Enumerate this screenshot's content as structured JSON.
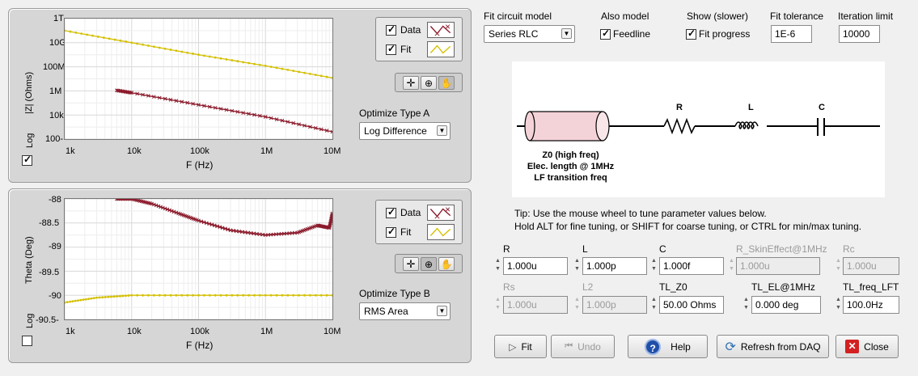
{
  "top_chart": {
    "y_label": "|Z| (Ohms)",
    "x_label": "F (Hz)",
    "y_ticks": [
      "1T",
      "10G",
      "100M",
      "1M",
      "10k",
      "100-"
    ],
    "x_ticks": [
      "1k",
      "10k",
      "100k",
      "1M",
      "10M"
    ],
    "log_label": "Log",
    "log_checked": true,
    "legend_data": "Data",
    "legend_fit": "Fit",
    "optimize_label": "Optimize Type A",
    "optimize_value": "Log Difference"
  },
  "bottom_chart": {
    "y_label": "Theta (Deg)",
    "x_label": "F (Hz)",
    "y_ticks": [
      "-88",
      "-88.5",
      "-89",
      "-89.5",
      "-90",
      "-90.5-"
    ],
    "x_ticks": [
      "1k",
      "10k",
      "100k",
      "1M",
      "10M"
    ],
    "log_label": "Log",
    "log_checked": false,
    "legend_data": "Data",
    "legend_fit": "Fit",
    "optimize_label": "Optimize Type B",
    "optimize_value": "RMS Area"
  },
  "chart_data": [
    {
      "type": "line",
      "title": "",
      "xlabel": "F (Hz)",
      "ylabel": "|Z| (Ohms)",
      "x_scale": "log",
      "y_scale": "log",
      "xlim": [
        1000,
        10000000
      ],
      "ylim": [
        100,
        1000000000000
      ],
      "series": [
        {
          "name": "Data",
          "color": "#8b1a2b",
          "x": [
            6000,
            10000,
            100000,
            1000000,
            10000000
          ],
          "y": [
            1100000,
            700000,
            70000,
            7000,
            400
          ]
        },
        {
          "name": "Fit",
          "color": "#d4c000",
          "x": [
            1000,
            10000,
            100000,
            1000000,
            10000000
          ],
          "y": [
            100000000000,
            10000000000,
            1000000000,
            120000000,
            12000000
          ]
        }
      ]
    },
    {
      "type": "line",
      "title": "",
      "xlabel": "F (Hz)",
      "ylabel": "Theta (Deg)",
      "x_scale": "log",
      "xlim": [
        1000,
        10000000
      ],
      "ylim": [
        -90.5,
        -88
      ],
      "series": [
        {
          "name": "Data",
          "color": "#8b1a2b",
          "x": [
            6000,
            10000,
            20000,
            50000,
            100000,
            300000,
            1000000,
            3000000,
            6000000,
            9000000,
            10000000
          ],
          "y": [
            -88.0,
            -88.0,
            -88.1,
            -88.3,
            -88.45,
            -88.65,
            -88.75,
            -88.7,
            -88.55,
            -88.6,
            -88.3
          ]
        },
        {
          "name": "Fit",
          "color": "#d4c000",
          "x": [
            1000,
            3000,
            10000,
            100000,
            1000000,
            10000000
          ],
          "y": [
            -90.15,
            -90.05,
            -90.0,
            -90.0,
            -90.0,
            -90.0
          ]
        }
      ]
    }
  ],
  "controls": {
    "fit_model_label": "Fit circuit model",
    "fit_model_value": "Series RLC",
    "also_model_label": "Also model",
    "feedline_label": "Feedline",
    "show_label": "Show (slower)",
    "fit_progress_label": "Fit progress",
    "tolerance_label": "Fit tolerance",
    "tolerance_value": "1E-6",
    "iteration_label": "Iteration limit",
    "iteration_value": "10000"
  },
  "circuit": {
    "r_label": "R",
    "l_label": "L",
    "c_label": "C",
    "z0_line1": "Z0 (high freq)",
    "z0_line2": "Elec. length @ 1MHz",
    "z0_line3": "LF transition freq"
  },
  "tips": {
    "line1": "Tip: Use the mouse wheel to tune parameter values below.",
    "line2": "Hold ALT for fine tuning, or SHIFT for coarse tuning, or CTRL for min/max tuning."
  },
  "params_row1": [
    {
      "label": "R",
      "value": "1.000u",
      "enabled": true
    },
    {
      "label": "L",
      "value": "1.000p",
      "enabled": true
    },
    {
      "label": "C",
      "value": "1.000f",
      "enabled": true
    },
    {
      "label": "R_SkinEffect@1MHz",
      "value": "1.000u",
      "enabled": false
    },
    {
      "label": "Rc",
      "value": "1.000u",
      "enabled": false
    }
  ],
  "params_row2": [
    {
      "label": "Rs",
      "value": "1.000u",
      "enabled": false
    },
    {
      "label": "L2",
      "value": "1.000p",
      "enabled": false
    },
    {
      "label": "TL_Z0",
      "value": "50.00 Ohms",
      "enabled": true
    },
    {
      "label": "TL_EL@1MHz",
      "value": "0.000 deg",
      "enabled": true
    },
    {
      "label": "TL_freq_LFT",
      "value": "100.0Hz",
      "enabled": true
    }
  ],
  "buttons": {
    "fit": "Fit",
    "undo": "Undo",
    "help": "Help",
    "refresh": "Refresh from DAQ",
    "close": "Close"
  }
}
